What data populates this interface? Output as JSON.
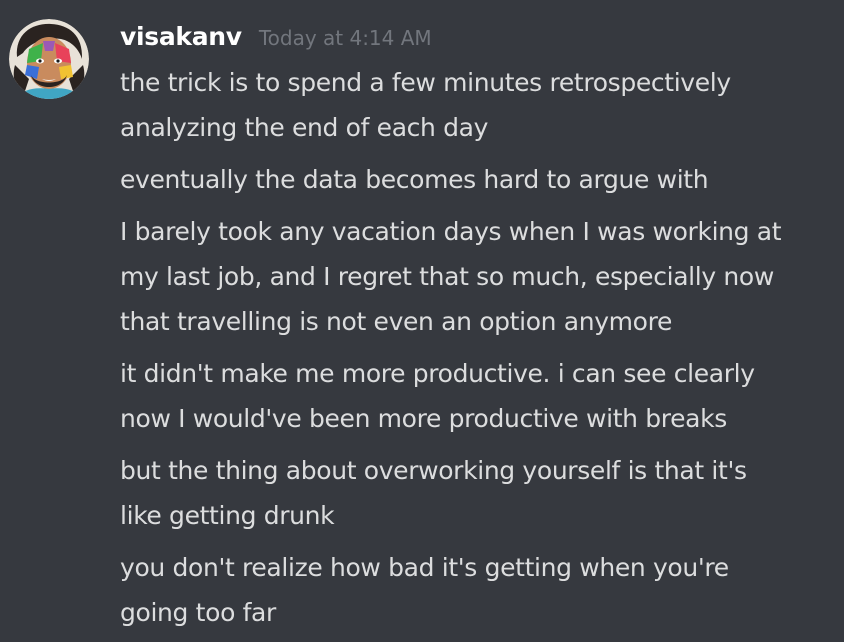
{
  "author": {
    "name": "visakanv",
    "timestamp": "Today at 4:14 AM",
    "avatar_icon": "user-avatar"
  },
  "colors": {
    "background": "#36393f",
    "username": "#ffffff",
    "timestamp": "#72767d",
    "message_text": "#dcddde"
  },
  "messages": [
    {
      "lines": [
        "the trick is to spend a few minutes retrospectively",
        "analyzing the end of each day"
      ]
    },
    {
      "lines": [
        "eventually the data becomes hard to argue with"
      ]
    },
    {
      "lines": [
        "I barely took any vacation days when I was working at",
        "my last job, and I regret that so much, especially now",
        "that travelling is not even an option anymore"
      ]
    },
    {
      "lines": [
        "it didn't make me more productive. i can see clearly",
        "now I would've been more productive with breaks"
      ]
    },
    {
      "lines": [
        "but the thing about overworking yourself is that it's",
        "like getting drunk"
      ]
    },
    {
      "lines": [
        "you don't realize how bad it's getting when you're",
        "going too far"
      ]
    }
  ]
}
